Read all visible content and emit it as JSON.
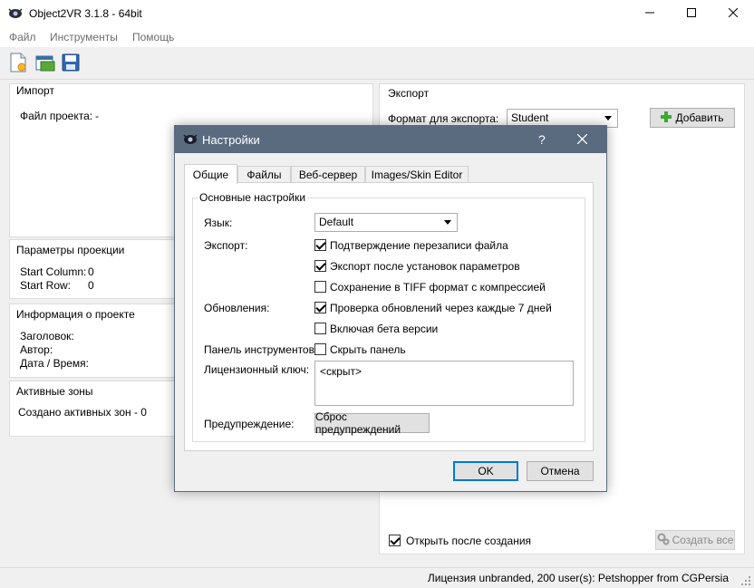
{
  "window": {
    "title": "Object2VR 3.1.8 - 64bit"
  },
  "menu": {
    "items": [
      "Файл",
      "Инструменты",
      "Помощь"
    ]
  },
  "toolbar": {
    "icons": [
      "new-project-icon",
      "open-project-icon",
      "save-icon"
    ]
  },
  "import_panel": {
    "title": "Импорт",
    "project_file_label": "Файл проекта:",
    "project_file_value": "-"
  },
  "projection": {
    "title": "Параметры проекции",
    "start_column_label": "Start Column:",
    "start_column_value": "0",
    "start_row_label": "Start Row:",
    "start_row_value": "0"
  },
  "project_info": {
    "title": "Информация о проекте",
    "heading_label": "Заголовок:",
    "author_label": "Автор:",
    "date_label": "Дата / Время:"
  },
  "hotspots": {
    "title": "Активные зоны",
    "created_text": "Создано активных зон - 0"
  },
  "export_panel": {
    "title": "Экспорт",
    "format_label": "Формат для экспорта:",
    "format_value": "Student",
    "add_button": "Добавить",
    "open_after_label": "Открыть после создания",
    "open_after_checked": true,
    "create_all_button": "Создать все"
  },
  "statusbar": {
    "text": "Лицензия unbranded, 200 user(s): Petshopper from CGPersia"
  },
  "dialog": {
    "title": "Настройки",
    "help": "?",
    "tabs": [
      "Общие",
      "Файлы",
      "Веб-сервер",
      "Images/Skin Editor"
    ],
    "active_tab": "Общие",
    "group_title": "Основные настройки",
    "language_label": "Язык:",
    "language_value": "Default",
    "export_label": "Экспорт:",
    "export_options": [
      {
        "label": "Подтверждение перезаписи файла",
        "checked": true
      },
      {
        "label": "Экспорт после установок параметров",
        "checked": true
      },
      {
        "label": "Сохранение в  TIFF формат с компрессией",
        "checked": false
      }
    ],
    "updates_label": "Обновления:",
    "update_options": [
      {
        "label": "Проверка обновлений через каждые 7 дней",
        "checked": true
      },
      {
        "label": "Включая бета версии",
        "checked": false
      }
    ],
    "toolbar_label": "Панель инструментов:",
    "hide_panel_label": "Скрыть панель",
    "hide_panel_checked": false,
    "license_label": "Лицензионный ключ:",
    "license_value": "<скрыт>",
    "warning_label": "Предупреждение:",
    "reset_warnings_button": "Сброс предупреждений",
    "ok_button": "OK",
    "cancel_button": "Отмена"
  }
}
